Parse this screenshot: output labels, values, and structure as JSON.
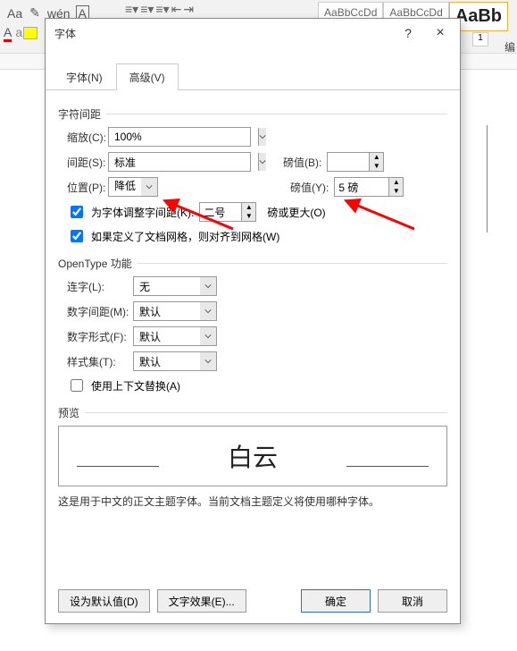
{
  "ribbon": {
    "styles": [
      "AaBbCcDd",
      "AaBbCcDd",
      "AaBb"
    ],
    "style_num": "1",
    "edit_label": "编辑"
  },
  "dialog": {
    "title": "字体",
    "help": "?",
    "close": "×",
    "tabs": {
      "font": "字体(N)",
      "advanced": "高级(V)"
    },
    "char_spacing": {
      "group_label": "字符间距",
      "scale_label": "缩放(C):",
      "scale_value": "100%",
      "spacing_label": "间距(S):",
      "spacing_value": "标准",
      "spacing_bylabel": "磅值(B):",
      "spacing_byvalue": "",
      "position_label": "位置(P):",
      "position_value": "降低",
      "position_bylabel": "磅值(Y):",
      "position_byvalue": "5 磅",
      "kerning_label": "为字体调整字间距(K):",
      "kerning_value": "二号",
      "kerning_suffix": "磅或更大(O)",
      "snap_label": "如果定义了文档网格，则对齐到网格(W)"
    },
    "opentype": {
      "group_label": "OpenType 功能",
      "ligatures_label": "连字(L):",
      "ligatures_value": "无",
      "numspacing_label": "数字间距(M):",
      "numspacing_value": "默认",
      "numforms_label": "数字形式(F):",
      "numforms_value": "默认",
      "styleset_label": "样式集(T):",
      "styleset_value": "默认",
      "contextual_label": "使用上下文替换(A)"
    },
    "preview": {
      "group_label": "预览",
      "text": "白云",
      "desc": "这是用于中文的正文主题字体。当前文档主题定义将使用哪种字体。"
    },
    "buttons": {
      "default": "设为默认值(D)",
      "effects": "文字效果(E)...",
      "ok": "确定",
      "cancel": "取消"
    }
  }
}
